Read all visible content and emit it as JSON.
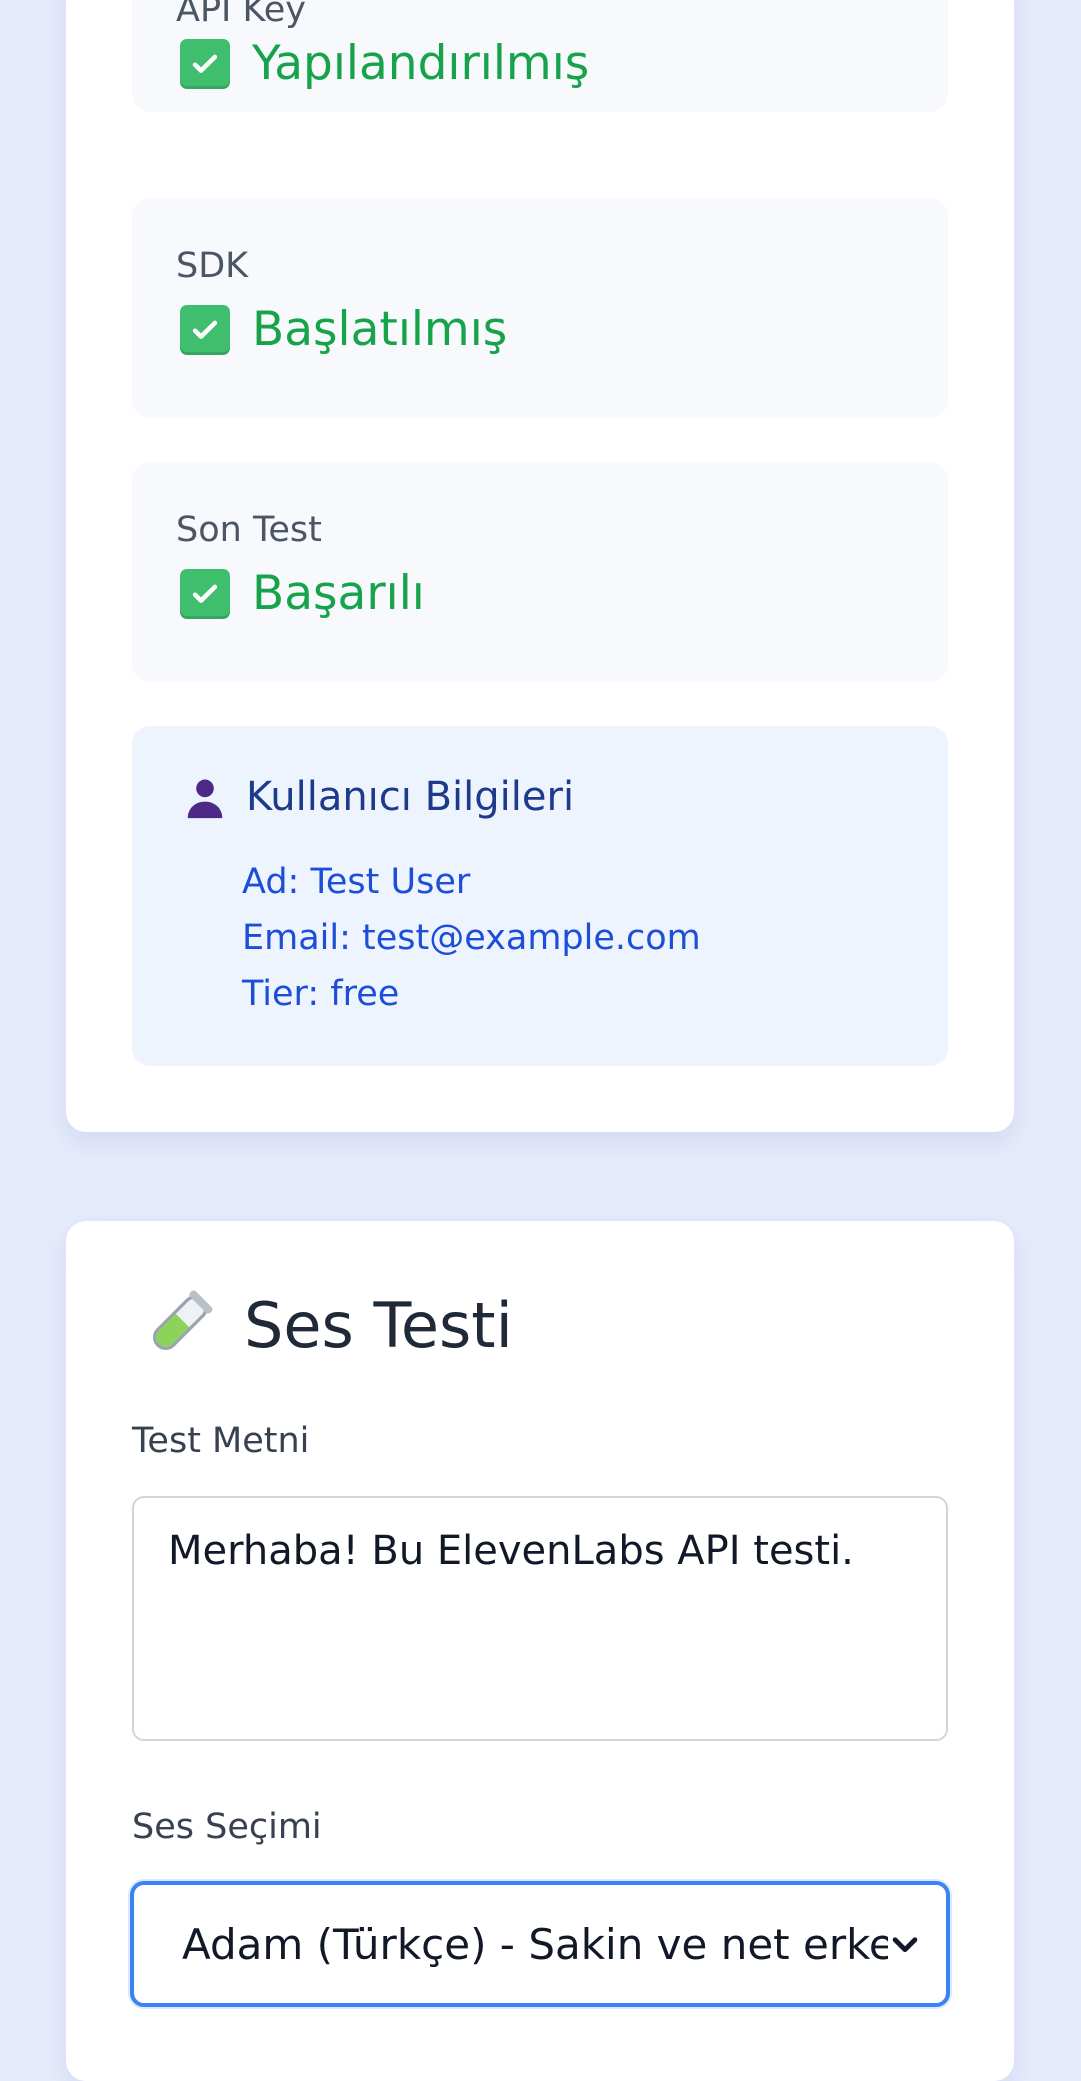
{
  "status": {
    "items": [
      {
        "label": "API Key",
        "value": "Yapılandırılmış",
        "icon": "check-mark-button-icon"
      },
      {
        "label": "SDK",
        "value": "Başlatılmış",
        "icon": "check-mark-button-icon"
      },
      {
        "label": "Son Test",
        "value": "Başarılı",
        "icon": "check-mark-button-icon"
      }
    ],
    "success_color": "#16a34a"
  },
  "user_info": {
    "title": "Kullanıcı Bilgileri",
    "icon": "user-silhouette-icon",
    "lines": [
      "Ad: Test User",
      "Email: test@example.com",
      "Tier: free"
    ]
  },
  "voice_test": {
    "title": "Ses Testi",
    "icon": "test-tube-icon",
    "text_label": "Test Metni",
    "text_value": "Merhaba! Bu ElevenLabs API testi.",
    "voice_label": "Ses Seçimi",
    "voice_selected": "Adam (Türkçe) - Sakin ve net erkek",
    "focus_color": "#3b82f6"
  }
}
